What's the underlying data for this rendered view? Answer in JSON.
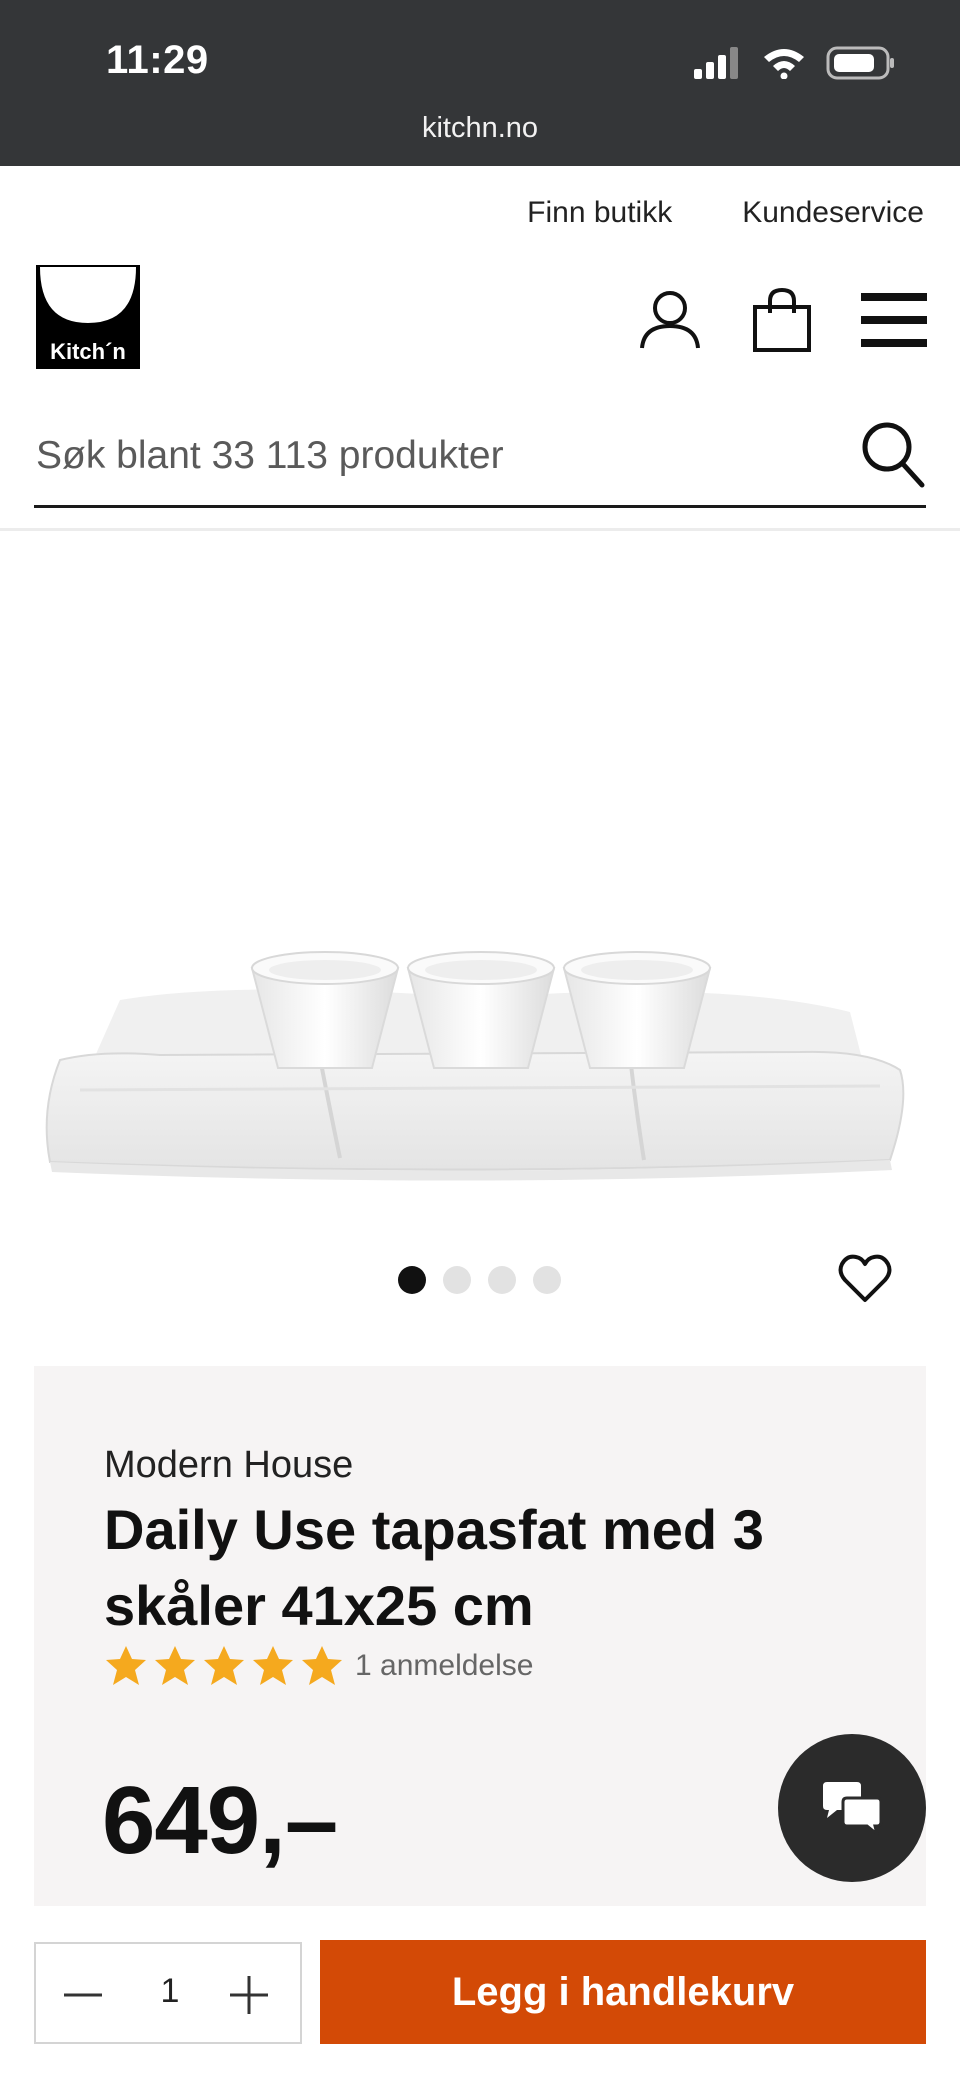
{
  "status": {
    "time": "11:29",
    "url": "kitchn.no"
  },
  "top_links": {
    "find_store": "Finn butikk",
    "customer_service": "Kundeservice"
  },
  "logo": {
    "text": "Kitch´n"
  },
  "search": {
    "placeholder": "Søk blant 33 113 produkter"
  },
  "gallery": {
    "slide_count": 4,
    "active_index": 0
  },
  "product": {
    "brand": "Modern House",
    "title": "Daily Use tapasfat med 3 skåler 41x25 cm",
    "rating": 5,
    "reviews": "1 anmeldelse",
    "price": "649,–"
  },
  "cart": {
    "quantity": "1",
    "button_label": "Legg i handlekurv"
  },
  "colors": {
    "status_bar": "#343638",
    "accent": "#d34a06",
    "star": "#f5a91e",
    "card_bg": "#f6f4f4"
  }
}
